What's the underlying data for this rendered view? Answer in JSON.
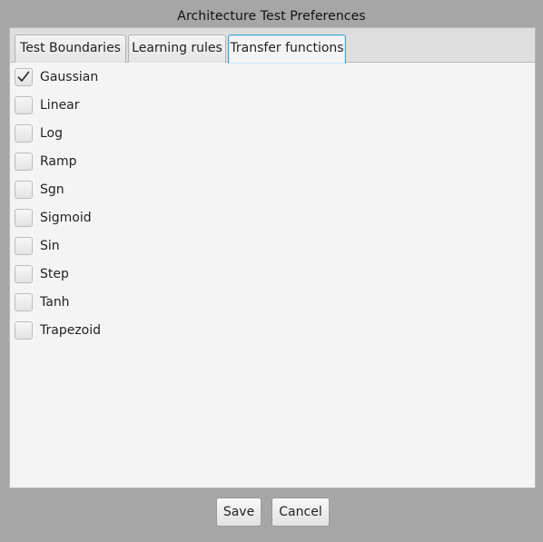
{
  "window": {
    "title": "Architecture Test Preferences"
  },
  "tabs": [
    {
      "label": "Test Boundaries",
      "active": false
    },
    {
      "label": "Learning rules",
      "active": false
    },
    {
      "label": "Transfer functions",
      "active": true
    }
  ],
  "transfer_functions": [
    {
      "label": "Gaussian",
      "checked": true
    },
    {
      "label": "Linear",
      "checked": false
    },
    {
      "label": "Log",
      "checked": false
    },
    {
      "label": "Ramp",
      "checked": false
    },
    {
      "label": "Sgn",
      "checked": false
    },
    {
      "label": "Sigmoid",
      "checked": false
    },
    {
      "label": "Sin",
      "checked": false
    },
    {
      "label": "Step",
      "checked": false
    },
    {
      "label": "Tanh",
      "checked": false
    },
    {
      "label": "Trapezoid",
      "checked": false
    }
  ],
  "buttons": {
    "save_label": "Save",
    "cancel_label": "Cancel"
  },
  "colors": {
    "background": "#a6a6a6",
    "panel": "#f4f4f4",
    "active_tab_border": "#3ba3d6"
  }
}
